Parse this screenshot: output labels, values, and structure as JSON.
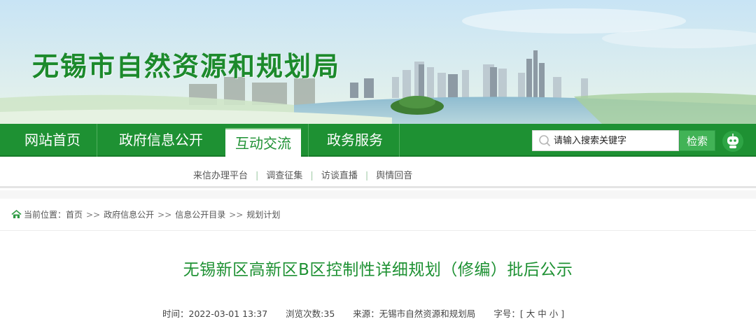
{
  "site": {
    "title": "无锡市自然资源和规划局"
  },
  "nav": {
    "items": [
      {
        "label": "网站首页"
      },
      {
        "label": "政府信息公开"
      },
      {
        "label": "互动交流"
      },
      {
        "label": "政务服务"
      }
    ],
    "active_index": 2,
    "search": {
      "placeholder": "请输入搜索关键字",
      "button_label": "检索"
    }
  },
  "subnav": {
    "items": [
      {
        "label": "来信办理平台"
      },
      {
        "label": "调查征集"
      },
      {
        "label": "访谈直播"
      },
      {
        "label": "舆情回音"
      }
    ],
    "separator": "|"
  },
  "breadcrumb": {
    "prefix": "当前位置：",
    "items": [
      "首页",
      "政府信息公开",
      "信息公开目录",
      "规划计划"
    ],
    "separator": ">>"
  },
  "article": {
    "title": "无锡新区高新区B区控制性详细规划（修编）批后公示",
    "time_label": "时间：",
    "time_value": "2022-03-01 13:37",
    "views_label": "浏览次数:",
    "views_value": "35",
    "source_label": "来源：",
    "source_value": "无锡市自然资源和规划局",
    "fontsize_label": "字号：",
    "fontsize_open": "[",
    "fontsize_large": "大",
    "fontsize_medium": "中",
    "fontsize_small": "小",
    "fontsize_close": "]"
  },
  "colors": {
    "brand_green": "#1e9133",
    "title_green": "#1c8a2c",
    "search_button": "#41b356"
  },
  "icons": {
    "search": "magnifier-icon",
    "assistant": "robot-assistant-icon",
    "home": "home-icon"
  }
}
